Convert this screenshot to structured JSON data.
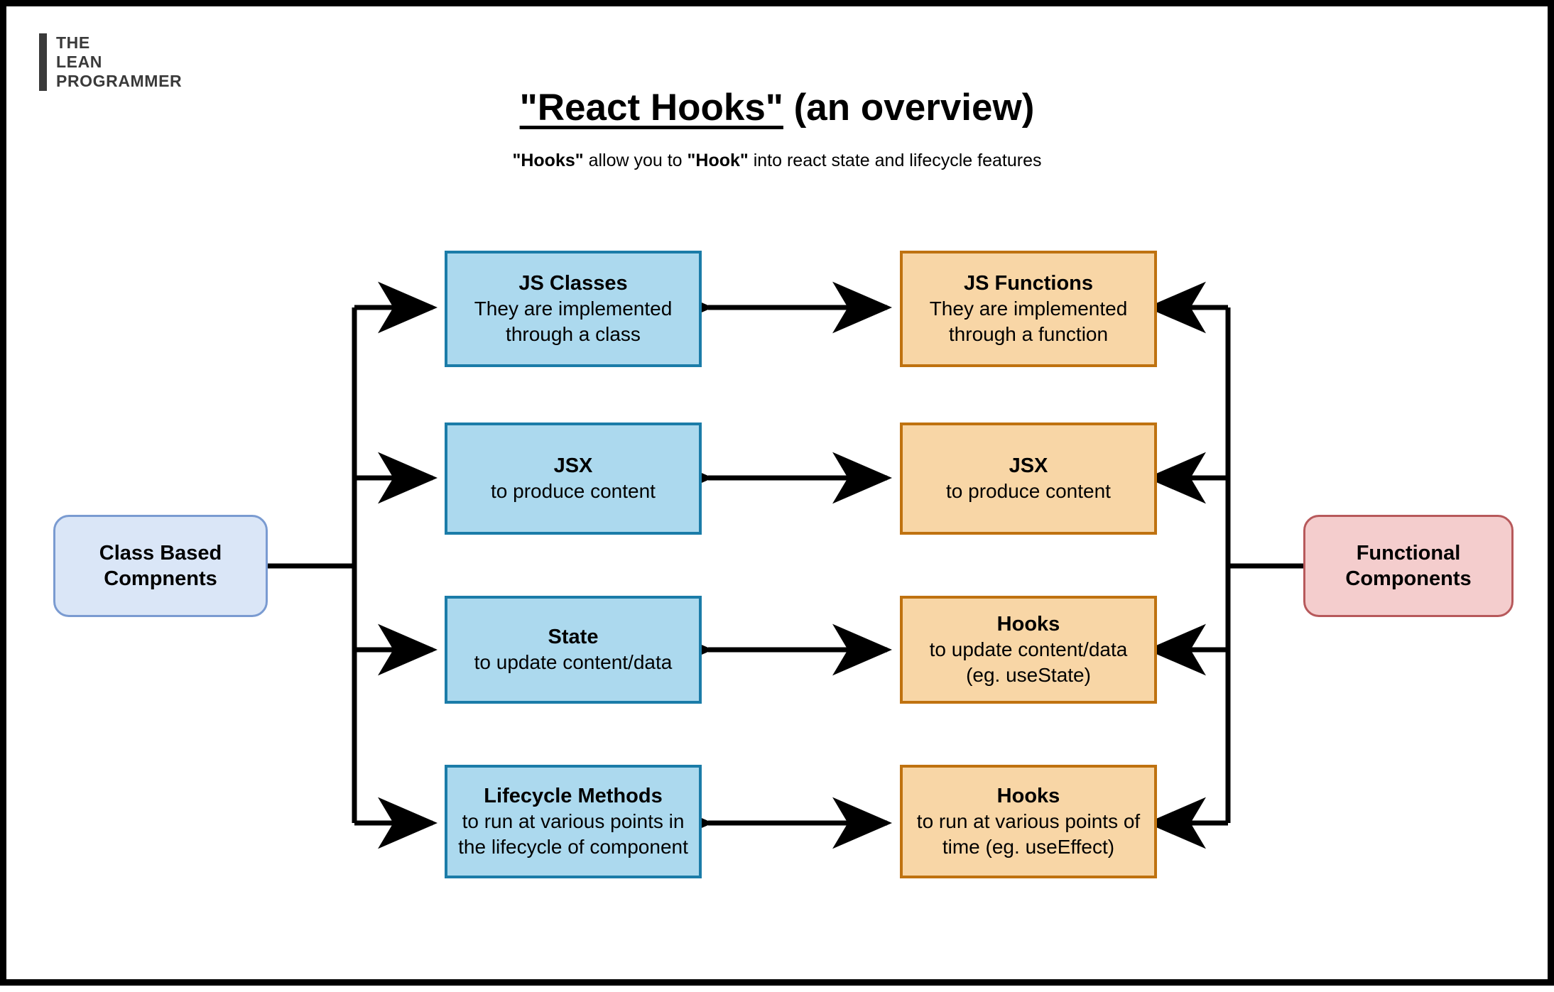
{
  "page": {
    "border_color": "#000000",
    "background": "#ffffff"
  },
  "logo": {
    "line1": "THE",
    "line2": "LEAN",
    "line3": "PROGRAMMER",
    "color": "#3a3a3a"
  },
  "header": {
    "title_quoted": "\"React Hooks\"",
    "title_rest": " (an overview)",
    "subtitle_a": "\"Hooks\"",
    "subtitle_b": " allow you to ",
    "subtitle_c": "\"Hook\"",
    "subtitle_d": " into react state and lifecycle features"
  },
  "colors": {
    "blue_fill": "#ACD9EE",
    "blue_border": "#1B7CA8",
    "orange_fill": "#F8D6A6",
    "orange_border": "#BF7210",
    "class_fill": "#DAE6F7",
    "class_border": "#7A9BD1",
    "func_fill": "#F4CDCD",
    "func_border": "#B7595B",
    "arrow": "#000000"
  },
  "roots": {
    "left": {
      "line1": "Class Based",
      "line2": "Compnents"
    },
    "right": {
      "line1": "Functional",
      "line2": "Components"
    }
  },
  "rows": [
    {
      "left": {
        "title": "JS Classes",
        "lines": [
          "They are implemented",
          "through a class"
        ]
      },
      "right": {
        "title": "JS Functions",
        "lines": [
          "They are implemented",
          "through a function"
        ]
      }
    },
    {
      "left": {
        "title": "JSX",
        "lines": [
          "to produce content"
        ]
      },
      "right": {
        "title": "JSX",
        "lines": [
          "to produce content"
        ]
      }
    },
    {
      "left": {
        "title": "State",
        "lines": [
          "to update content/data"
        ]
      },
      "right": {
        "title": "Hooks",
        "lines": [
          "to update content/data",
          "(eg. useState)"
        ]
      }
    },
    {
      "left": {
        "title": "Lifecycle Methods",
        "lines": [
          "to run at various points in",
          "the lifecycle of component"
        ]
      },
      "right": {
        "title": "Hooks",
        "lines": [
          "to run at various points of",
          "time (eg. useEffect)"
        ]
      }
    }
  ]
}
